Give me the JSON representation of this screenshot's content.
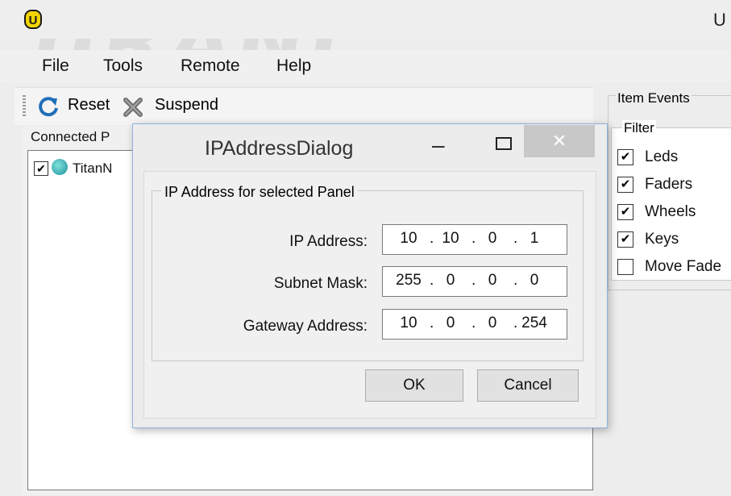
{
  "window": {
    "title": "U",
    "logo_letter": "U",
    "watermark": "URANI",
    "accent": "#f2d400"
  },
  "menu": [
    "File",
    "Tools",
    "Remote",
    "Help"
  ],
  "toolbar": {
    "reset": "Reset",
    "suspend": "Suspend"
  },
  "left_panel": {
    "header": "Connected P",
    "tree_item": "TitanN",
    "tree_item_checked": true
  },
  "right_panel": {
    "group": "Item Events",
    "filter_label": "Filter",
    "filters": [
      {
        "label": "Leds",
        "checked": true
      },
      {
        "label": "Faders",
        "checked": true
      },
      {
        "label": "Wheels",
        "checked": true
      },
      {
        "label": "Keys",
        "checked": true
      },
      {
        "label": "Move Fade",
        "checked": false
      }
    ]
  },
  "dialog": {
    "title": "IPAddressDialog",
    "minimize": "–",
    "close": "✕",
    "group_label": "IP Address for selected Panel",
    "fields": [
      {
        "label": "IP Address:",
        "octets": [
          "10",
          "10",
          "0",
          "1"
        ]
      },
      {
        "label": "Subnet Mask:",
        "octets": [
          "255",
          "0",
          "0",
          "0"
        ]
      },
      {
        "label": "Gateway Address:",
        "octets": [
          "10",
          "0",
          "0",
          "254"
        ]
      }
    ],
    "ok": "OK",
    "cancel": "Cancel"
  }
}
